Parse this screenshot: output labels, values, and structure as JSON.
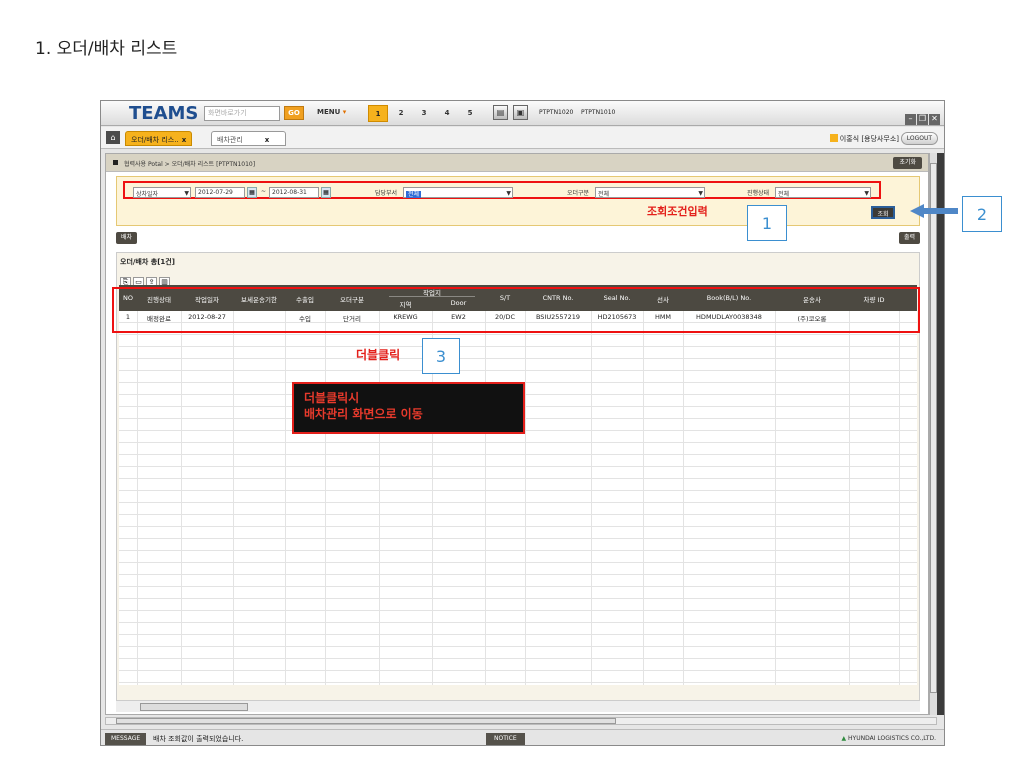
{
  "heading": "1. 오더/배차 리스트",
  "topbar": {
    "logo": "TEAMS",
    "search_placeholder": "화면바로가기",
    "go": "GO",
    "menu": "MENU",
    "pages": [
      "1",
      "2",
      "3",
      "4",
      "5"
    ],
    "program_tabs": [
      "PTPTN1020",
      "PTPTN1010"
    ]
  },
  "tabs": {
    "items": [
      {
        "label": "오더/배차 리스..",
        "close": "x"
      },
      {
        "label": "배차관리",
        "close": "x"
      }
    ],
    "user": "이홍식 [용당사무소]",
    "logout": "LOGOUT"
  },
  "crumb": {
    "text": "협력사용 Potal > 오더/배차 리스트 [PTPTN1010]",
    "reset": "초기화"
  },
  "cond": {
    "date_type": "상차일자",
    "date_from": "2012-07-29",
    "date_sep": "~",
    "date_to": "2012-08-31",
    "dept_label": "담당부서",
    "dept_value": "전체",
    "order_label": "오더구분",
    "order_value": "전체",
    "status_label": "진행상태",
    "status_value": "전체",
    "search": "조회"
  },
  "annotations": {
    "cond_input": "조회조건입력",
    "one": "1",
    "two": "2",
    "dbl": "더블클릭",
    "three": "3",
    "popup_line1": "더블클릭시",
    "popup_line2": "배차관리 화면으로 이동"
  },
  "actions": {
    "dispatch": "배차",
    "print": "출력"
  },
  "list": {
    "title": "오더/배차 총[1건]"
  },
  "grid": {
    "headers": [
      "NO",
      "진행상태",
      "작업일자",
      "보세운송기한",
      "수출입",
      "오더구분",
      "작업지",
      "지역",
      "Door",
      "S/T",
      "CNTR No.",
      "Seal No.",
      "선사",
      "Book(B/L) No.",
      "운송사",
      "차량 ID"
    ],
    "row": [
      "1",
      "배정완료",
      "2012-08-27",
      "",
      "수입",
      "단거리",
      "KREWG",
      "EW2",
      "20/DC",
      "BSIU2557219",
      "HD2105673",
      "HMM",
      "HDMUDLAY0038348",
      "(주)코오롱",
      ""
    ]
  },
  "status": {
    "label": "MESSAGE",
    "message": "배차 조회값이 출력되었습니다.",
    "notice": "NOTICE",
    "company": "HYUNDAI LOGISTICS CO.,LTD."
  }
}
